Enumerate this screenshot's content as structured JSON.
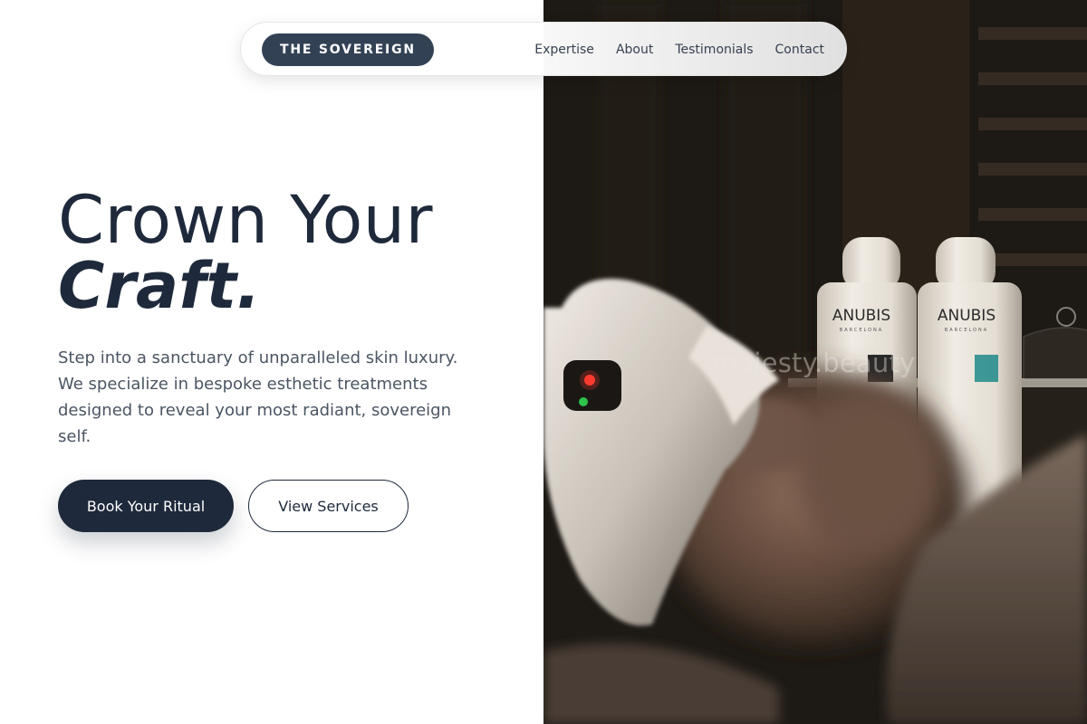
{
  "nav": {
    "brand": "THE SOVEREIGN",
    "links": [
      "Expertise",
      "About",
      "Testimonials",
      "Contact"
    ]
  },
  "hero": {
    "title_line1": "Crown Your",
    "title_line2": "Craft.",
    "description": "Step into a sanctuary of unparalleled skin luxury. We specialize in bespoke esthetic treatments designed to reveal your most radiant, sovereign self.",
    "primary_button": "Book Your Ritual",
    "secondary_button": "View Services"
  },
  "photo": {
    "bottle_label": "ANUBIS",
    "bottle_sublabel": "BARCELONA",
    "watermark": "majesty.beauty"
  },
  "colors": {
    "primary": "#1e293b",
    "brand_badge": "#334155",
    "body_text": "#4b5563",
    "nav_text": "#374151"
  }
}
